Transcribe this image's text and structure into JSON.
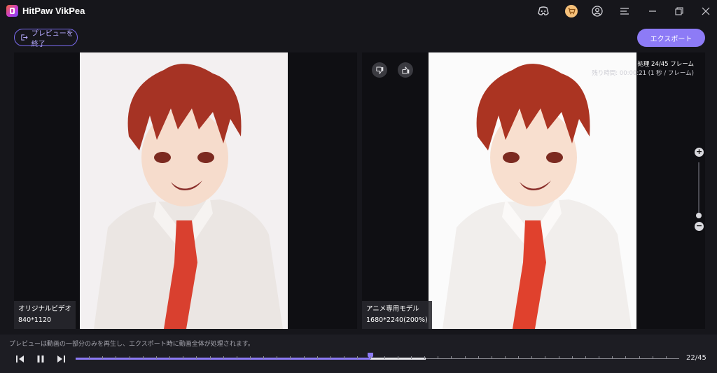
{
  "window": {
    "title": "HitPaw VikPea"
  },
  "titlebar": {
    "icons": [
      "discord-icon",
      "cart-icon",
      "account-icon",
      "menu-icon",
      "minimize-icon",
      "restore-icon",
      "close-icon"
    ]
  },
  "toolbar": {
    "exit_label": "プレビューを終了",
    "export_label": "エクスポート"
  },
  "original": {
    "name": "オリジナルビデオ",
    "resolution": "840*1120"
  },
  "enhanced": {
    "name": "アニメ専用モデル",
    "resolution": "1680*2240(200%)"
  },
  "progress": {
    "processing": "処理 24/45 フレーム",
    "remaining": "残り時間: 00:00:21 (1 秒 / フレーム)"
  },
  "zoom": {
    "plus": "+",
    "minus": "−",
    "level": 0.1
  },
  "footer": {
    "note": "プレビューは動画の一部分のみを再生し、エクスポート時に動画全体が処理されます。",
    "frame_counter": "22/45"
  },
  "timeline": {
    "current_frame": 22,
    "total_frames": 45,
    "processed_frames": 24
  },
  "colors": {
    "accent": "#8d7bf6",
    "background": "#16161b",
    "panel": "#0f0f13"
  }
}
